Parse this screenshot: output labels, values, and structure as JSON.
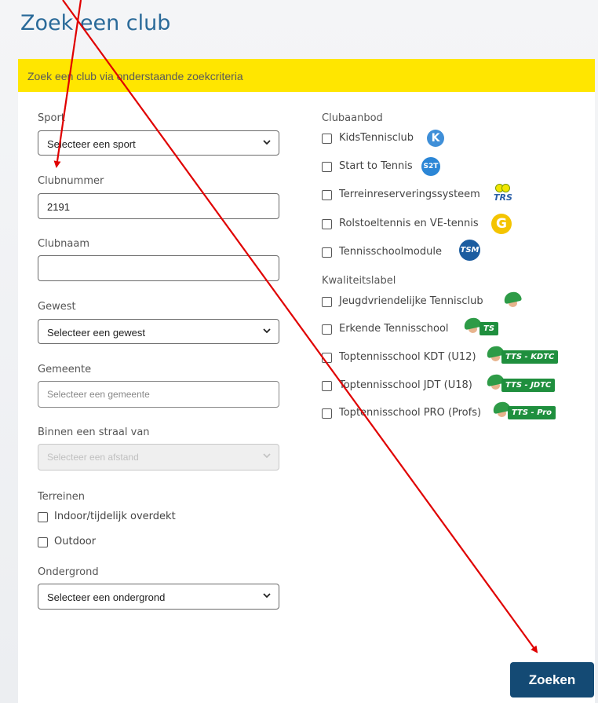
{
  "page": {
    "title": "Zoek een club"
  },
  "banner": {
    "text": "Zoek een club via onderstaande zoekcriteria"
  },
  "form": {
    "sport": {
      "label": "Sport",
      "value": "Selecteer een sport"
    },
    "clubnummer": {
      "label": "Clubnummer",
      "value": "2191"
    },
    "clubnaam": {
      "label": "Clubnaam",
      "value": ""
    },
    "gewest": {
      "label": "Gewest",
      "value": "Selecteer een gewest"
    },
    "gemeente": {
      "label": "Gemeente",
      "placeholder": "Selecteer een gemeente"
    },
    "straal": {
      "label": "Binnen een straal van",
      "value": "Selecteer een afstand"
    },
    "terreinen": {
      "label": "Terreinen",
      "options": [
        "Indoor/tijdelijk overdekt",
        "Outdoor"
      ]
    },
    "ondergrond": {
      "label": "Ondergrond",
      "value": "Selecteer een ondergrond"
    },
    "clubaanbod": {
      "label": "Clubaanbod",
      "options": [
        "KidsTennisclub",
        "Start to Tennis",
        "Terreinreserveringssysteem",
        "Rolstoeltennis en VE-tennis",
        "Tennisschoolmodule"
      ],
      "badges": [
        "K",
        "S2T",
        "TRS",
        "G",
        "TSM"
      ]
    },
    "kwaliteitslabel": {
      "label": "Kwaliteitslabel",
      "options": [
        "Jeugdvriendelijke Tennisclub",
        "Erkende Tennisschool",
        "Toptennisschool KDT (U12)",
        "Toptennisschool JDT (U18)",
        "Toptennisschool PRO (Profs)"
      ],
      "badges": [
        "",
        "TS",
        "TTS - KDTC",
        "TTS - JDTC",
        "TTS - Pro"
      ]
    },
    "submit_label": "Zoeken"
  },
  "colors": {
    "accent": "#144a74",
    "banner": "#ffe600",
    "title": "#2a6a99",
    "annotation": "#e00000"
  }
}
